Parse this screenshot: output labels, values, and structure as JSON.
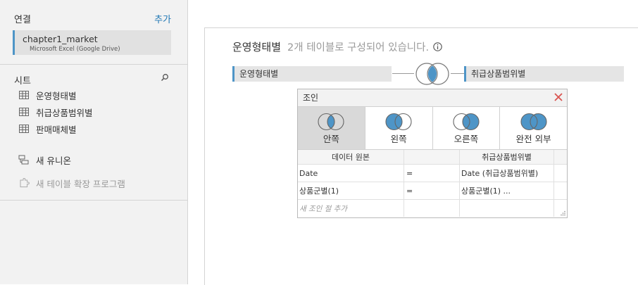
{
  "sidebar": {
    "connections_label": "연결",
    "add_label": "추가",
    "connection": {
      "name": "chapter1_market",
      "type": "Microsoft Excel (Google Drive)"
    },
    "sheets_label": "시트",
    "sheets": [
      {
        "label": "운영형태별"
      },
      {
        "label": "취급상품범위별"
      },
      {
        "label": "판매매체별"
      }
    ],
    "new_union_label": "새 유니온",
    "new_extension_label": "새 테이블 확장 프로그램"
  },
  "canvas": {
    "title": "운영형태별",
    "subtitle": "2개 테이블로 구성되어 있습니다.",
    "left_table": "운영형태별",
    "right_table": "취급상품범위별"
  },
  "join_dialog": {
    "title": "조인",
    "join_types": [
      {
        "label": "안쪽",
        "selected": true
      },
      {
        "label": "왼쪽",
        "selected": false
      },
      {
        "label": "오른쪽",
        "selected": false
      },
      {
        "label": "완전 외부",
        "selected": false
      }
    ],
    "columns": {
      "left": "데이터 원본",
      "right": "취급상품범위별"
    },
    "clauses": [
      {
        "left": "Date",
        "op": "=",
        "right": "Date (취급상품범위별)"
      },
      {
        "left": "상품군별(1)",
        "op": "=",
        "right": "상품군별(1) ..."
      }
    ],
    "new_clause_label": "새 조인 절 추가"
  },
  "colors": {
    "accent": "#4e95c7",
    "close": "#d9534f",
    "link": "#1f77b4"
  }
}
